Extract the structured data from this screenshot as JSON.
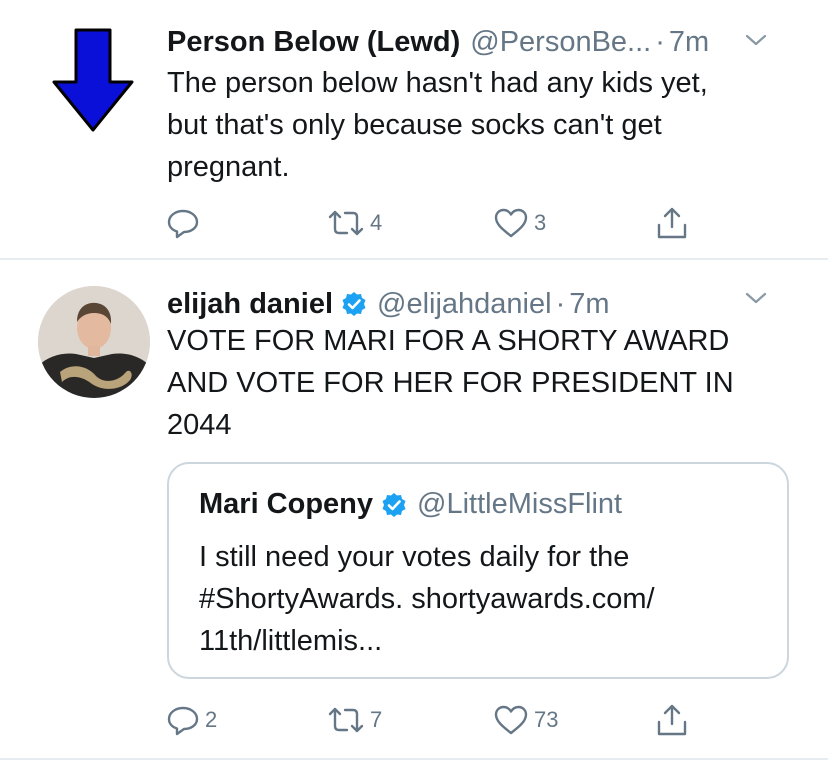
{
  "tweets": [
    {
      "name": "Person Below (Lewd)",
      "handle": "@PersonBe...",
      "separator": "·",
      "time": "7m",
      "lines": [
        "The person below hasn't had any kids yet,",
        "but that's only because socks can't get",
        "pregnant."
      ],
      "reply_count": "",
      "retweet_count": "4",
      "like_count": "3"
    },
    {
      "name": "elijah daniel",
      "verified": true,
      "handle": "@elijahdaniel",
      "separator": "·",
      "time": "7m",
      "lines": [
        "VOTE FOR MARI FOR A SHORTY AWARD",
        "AND VOTE FOR HER FOR PRESIDENT IN",
        "2044"
      ],
      "quote": {
        "name": "Mari Copeny",
        "verified": true,
        "handle": "@LittleMissFlint",
        "lines": [
          "I still need your votes daily for the",
          "#ShortyAwards. shortyawards.com/",
          "11th/littlemis..."
        ]
      },
      "reply_count": "2",
      "retweet_count": "7",
      "like_count": "73"
    }
  ],
  "colors": {
    "arrow_fill": "#0a10d8",
    "verified_blue": "#1da1f2",
    "muted_gray": "#657786",
    "border": "#ccd6dd"
  },
  "icons": {
    "avatar_1": "blue-down-arrow-icon",
    "reply": "reply-icon",
    "retweet": "retweet-icon",
    "like": "heart-icon",
    "share": "share-icon",
    "caret": "chevron-down-icon",
    "verified": "verified-badge-icon"
  }
}
